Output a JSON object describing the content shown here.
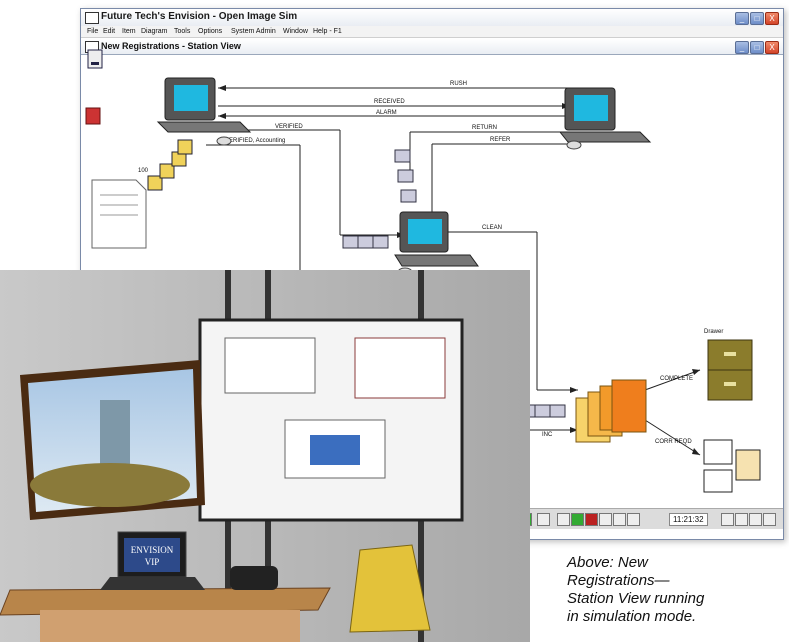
{
  "window": {
    "title": "Future Tech's Envision - Open Image Sim",
    "menu": [
      "File",
      "Edit",
      "Item",
      "Diagram",
      "Tools",
      "Options",
      "System Admin",
      "Window",
      "Help - F1"
    ],
    "controls": [
      "_",
      "□",
      "X"
    ]
  },
  "child_window": {
    "title": "New Registrations - Station View",
    "controls": [
      "_",
      "□",
      "X"
    ]
  },
  "flows": {
    "rush": "RUSH",
    "received": "RECEIVED",
    "alarm": "ALARM",
    "verified": "VERIFIED",
    "verified_accounting": "VERIFIED, Accounting",
    "return": "RETURN",
    "refer": "REFER",
    "clean": "CLEAN",
    "complete": "COMPLETE",
    "inc": "INC",
    "corr_reqd": "CORR REQD",
    "hundred": "100",
    "cabinet_label": "Drawer"
  },
  "status": {
    "clock": "11:21:32"
  },
  "office": {
    "laptop_text_1": "ENVISION",
    "laptop_text_2": "VIP"
  },
  "caption": {
    "line1": "Above:  New",
    "line2": "Registrations—",
    "line3": "Station View running",
    "line4": "in simulation mode."
  },
  "colors": {
    "accent": "#5a7dc8",
    "folder": "#f29a2a",
    "cabinet": "#8b7c2c"
  }
}
